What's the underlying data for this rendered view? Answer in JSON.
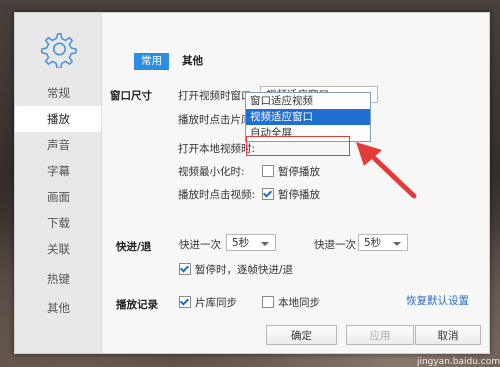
{
  "sidebar": {
    "items": [
      {
        "label": "常规",
        "active": false
      },
      {
        "label": "播放",
        "active": true
      },
      {
        "label": "声音",
        "active": false
      },
      {
        "label": "字幕",
        "active": false
      },
      {
        "label": "画面",
        "active": false
      },
      {
        "label": "下载",
        "active": false
      },
      {
        "label": "关联",
        "active": false
      },
      {
        "label": "热键",
        "active": false
      },
      {
        "label": "其他",
        "active": false
      }
    ]
  },
  "tabs": [
    {
      "label": "常用",
      "active": true
    },
    {
      "label": "其他",
      "active": false
    }
  ],
  "window_size": {
    "section_label": "窗口尺寸",
    "open_video_label": "打开视频时窗口:",
    "open_video_value": "视频适应窗口",
    "dropdown_options": [
      "窗口适应视频",
      "视频适应窗口",
      "自动全屏"
    ],
    "dropdown_selected": "视频适应窗口",
    "click_library_label": "播放时点击片库:",
    "open_local_label": "打开本地视频时:",
    "minimize_label": "视频最小化时:",
    "minimize_pause": {
      "label": "暂停播放",
      "checked": false
    },
    "click_video_label": "播放时点击视频:",
    "click_video_pause": {
      "label": "暂停播放",
      "checked": true
    }
  },
  "seek": {
    "section_label": "快进/退",
    "forward_label": "快进一次",
    "forward_value": "5秒",
    "backward_label": "快退一次",
    "backward_value": "5秒",
    "pause_frame": {
      "label": "暂停时，逐帧快进/退",
      "checked": true
    }
  },
  "record": {
    "section_label": "播放记录",
    "library_sync": {
      "label": "片库同步",
      "checked": true
    },
    "local_sync": {
      "label": "本地同步",
      "checked": false
    }
  },
  "restore_defaults": "恢复默认设置",
  "buttons": {
    "ok": "确定",
    "apply": "应用",
    "cancel": "取消"
  },
  "watermark": "jingyan.baidu.com",
  "colors": {
    "accent": "#2b8ee3",
    "selection": "#1f6fd0",
    "highlight": "#e53a3a"
  }
}
